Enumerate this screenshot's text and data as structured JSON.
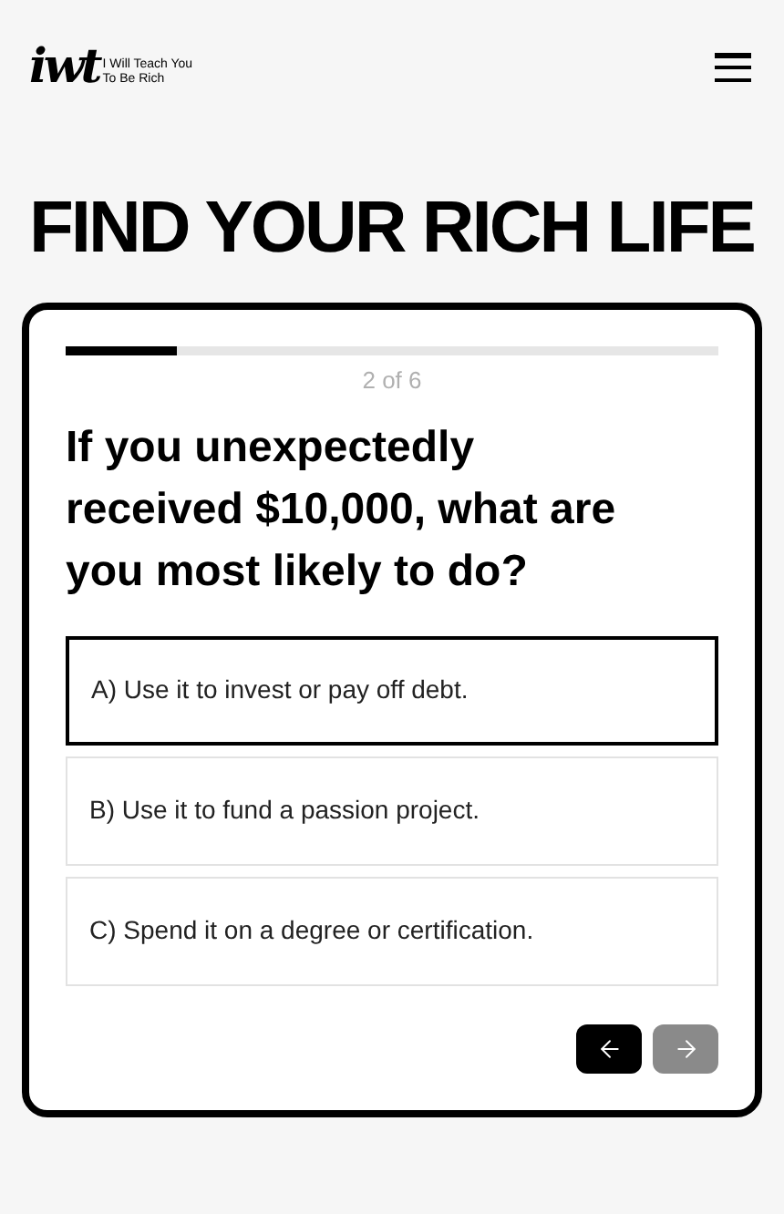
{
  "header": {
    "logo_mark": "iwt",
    "logo_line_1": "I Will Teach You",
    "logo_line_2": "To Be Rich"
  },
  "heading": "FIND YOUR RICH LIFE",
  "quiz": {
    "progress": {
      "level": 0.17
    },
    "counter": "2 of 6",
    "question": "If you unexpectedly received $10,000, what are you most likely to do?",
    "options": [
      {
        "label": "A) Use it to invest or pay off debt.",
        "selected": true
      },
      {
        "label": "B) Use it to fund a passion project.",
        "selected": false
      },
      {
        "label": "C) Spend it on a degree or certification.",
        "selected": false
      }
    ],
    "back_button": {
      "disabled": false
    },
    "next_button": {
      "disabled": true
    }
  }
}
